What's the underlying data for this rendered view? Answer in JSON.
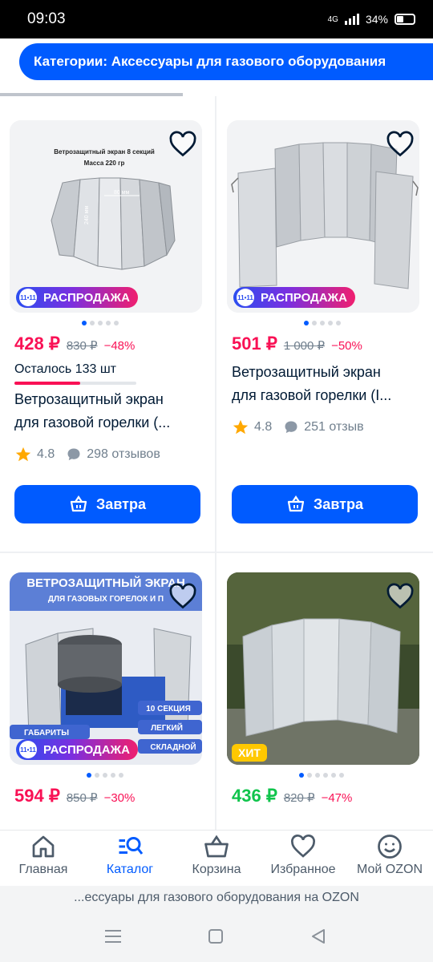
{
  "status": {
    "time": "09:03",
    "network": "4G",
    "battery": "34%"
  },
  "category_chip": "Категории: Аксессуары для газового оборудования",
  "products": [
    {
      "image_caption_1": "Ветрозащитный экран 8 секций",
      "image_caption_2": "Масса 220 гр",
      "image_dim_1": "80 мм",
      "image_dim_2": "240 мм",
      "badge": "РАСПРОДАЖА",
      "price": "428 ₽",
      "old_price": "830 ₽",
      "discount": "−48%",
      "stock": "Осталось 133 шт",
      "stock_level": 0.54,
      "title_1": "Ветрозащитный экран",
      "title_2": "для газовой горелки (...",
      "rating": "4.8",
      "reviews": "298 отзывов",
      "button": "Завтра"
    },
    {
      "badge": "РАСПРОДАЖА",
      "price": "501 ₽",
      "old_price": "1 000 ₽",
      "discount": "−50%",
      "title_1": "Ветрозащитный экран",
      "title_2": "для газовой горелки (I...",
      "rating": "4.8",
      "reviews": "251 отзыв",
      "button": "Завтра"
    },
    {
      "image_title": "ВЕТРОЗАЩИТНЫЙ ЭКРАН",
      "image_subtitle": "ДЛЯ ГАЗОВЫХ ГОРЕЛОК И П",
      "image_tag_1": "10 СЕКЦИЯ",
      "image_tag_2": "ЛЕГКИЙ",
      "image_tag_3": "СКЛАДНОЙ",
      "image_tag_4": "ГАБАРИТЫ",
      "badge": "РАСПРОДАЖА",
      "price": "594 ₽",
      "old_price": "850 ₽",
      "discount": "−30%"
    },
    {
      "badge": "ХИТ",
      "price": "436 ₽",
      "old_price": "820 ₽",
      "discount": "−47%"
    }
  ],
  "nav": {
    "home": "Главная",
    "catalog": "Каталог",
    "cart": "Корзина",
    "favorites": "Избранное",
    "profile": "Мой OZON"
  },
  "url_text": "...ессуары для газового оборудования на OZON",
  "colors": {
    "accent": "#005bff",
    "price": "#f91155",
    "green_price": "#10c44c"
  }
}
